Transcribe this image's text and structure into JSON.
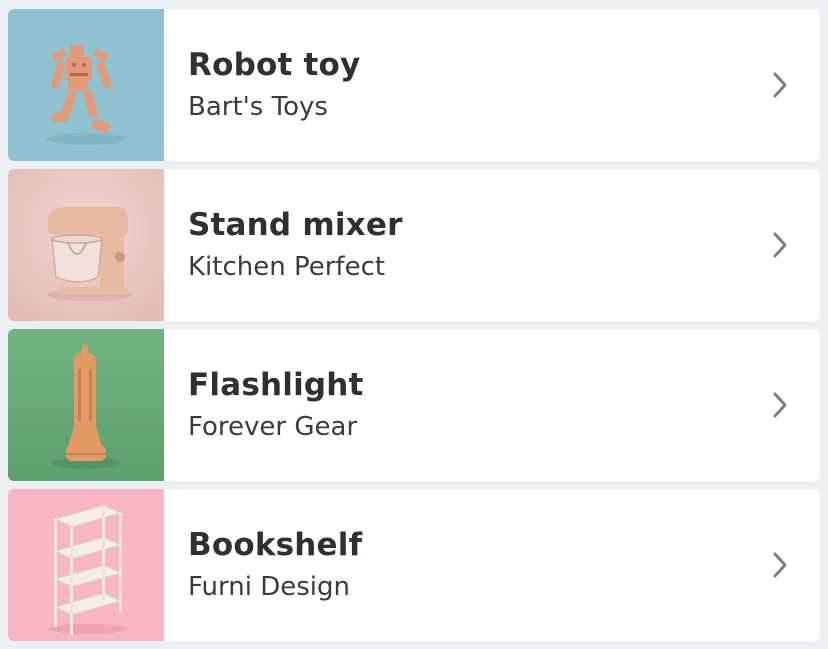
{
  "items": [
    {
      "title": "Robot toy",
      "vendor": "Bart's Toys",
      "thumb_bg": "#8fc2ce",
      "thumb_icon": "robot-toy-image"
    },
    {
      "title": "Stand mixer",
      "vendor": "Kitchen Perfect",
      "thumb_bg": "#e9c8c2",
      "thumb_icon": "stand-mixer-image"
    },
    {
      "title": "Flashlight",
      "vendor": "Forever Gear",
      "thumb_bg": "#6aab7a",
      "thumb_icon": "flashlight-image"
    },
    {
      "title": "Bookshelf",
      "vendor": "Furni Design",
      "thumb_bg": "#f8b6c5",
      "thumb_icon": "bookshelf-image"
    }
  ],
  "chevron_icon": "chevron-right-icon",
  "colors": {
    "background": "#ebeef3",
    "card": "#ffffff",
    "title": "#2e3036",
    "subtitle": "#3a3c42",
    "chevron": "#7c828c"
  }
}
